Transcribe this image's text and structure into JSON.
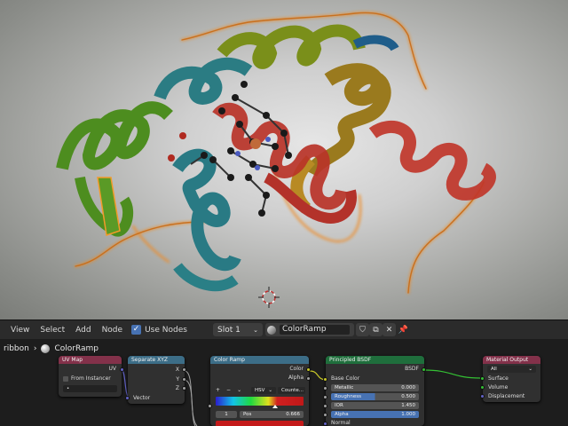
{
  "header": {
    "menus": [
      "View",
      "Select",
      "Add",
      "Node"
    ],
    "use_nodes": "Use Nodes",
    "slot": "Slot 1",
    "material": "ColorRamp"
  },
  "breadcrumb": {
    "object": "ribbon",
    "material": "ColorRamp"
  },
  "nodes": {
    "uv_map": {
      "title": "UV Map",
      "uv": "UV",
      "from_instancer": "From Instancer"
    },
    "separate_xyz": {
      "title": "Separate XYZ",
      "x": "X",
      "y": "Y",
      "z": "Z",
      "vector": "Vector"
    },
    "color_ramp": {
      "title": "Color Ramp",
      "color": "Color",
      "alpha": "Alpha",
      "plus": "+",
      "minus": "−",
      "interp_mode": "HSV",
      "hue_mode": "Counte...",
      "index": "1",
      "pos_label": "Pos",
      "pos_value": "0.666"
    },
    "principled": {
      "title": "Principled BSDF",
      "bsdf": "BSDF",
      "base_color": "Base Color",
      "metallic_label": "Metallic",
      "metallic": "0.000",
      "roughness_label": "Roughness",
      "roughness": "0.500",
      "ior_label": "IOR",
      "ior": "1.450",
      "alpha_label": "Alpha",
      "alpha": "1.000",
      "normal": "Normal"
    },
    "output": {
      "title": "Material Output",
      "target": "All",
      "surface": "Surface",
      "volume": "Volume",
      "displacement": "Displacement"
    }
  },
  "colors": {
    "uv_header": "#83314a",
    "sep_header": "#3c6d87",
    "ramp_header": "#3c6d87",
    "bsdf_header": "#1f6e3c",
    "out_header": "#83314a",
    "accent": "#4772b3"
  },
  "icons": [
    "checkbox-icon",
    "sphere-icon",
    "shield-icon",
    "duplicate-icon",
    "close-icon",
    "pin-icon",
    "chevron-right-icon",
    "cursor-3d-icon"
  ]
}
